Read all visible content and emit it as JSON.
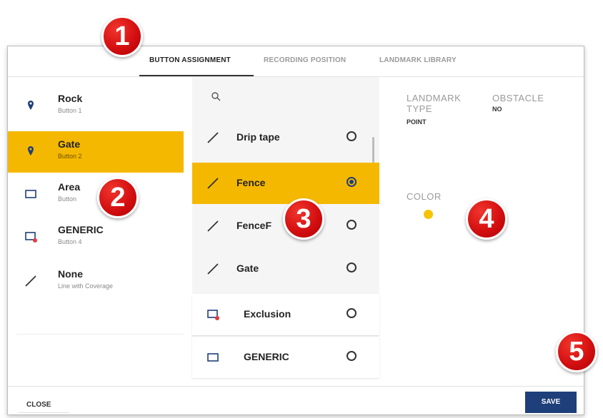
{
  "tabs": [
    {
      "label": "BUTTON ASSIGNMENT",
      "active": true
    },
    {
      "label": "RECORDING POSITION",
      "active": false
    },
    {
      "label": "LANDMARK LIBRARY",
      "active": false
    }
  ],
  "buttons": [
    {
      "title": "Rock",
      "sub": "Button 1",
      "icon": "map-pin-icon",
      "selected": false
    },
    {
      "title": "Gate",
      "sub": "Button 2",
      "icon": "map-pin-icon",
      "selected": true
    },
    {
      "title": "Area",
      "sub": "Button",
      "icon": "rectangle-icon",
      "selected": false
    },
    {
      "title": "GENERIC",
      "sub": "Button 4",
      "icon": "rectangle-flag-icon",
      "selected": false
    },
    {
      "title": "None",
      "sub": "Line with Coverage",
      "icon": "line-icon",
      "selected": false
    }
  ],
  "landmarks": [
    {
      "label": "Drip tape",
      "icon": "line-icon",
      "selected": false
    },
    {
      "label": "Fence",
      "icon": "line-icon",
      "selected": true
    },
    {
      "label": "FenceF",
      "icon": "line-icon",
      "selected": false
    },
    {
      "label": "Gate",
      "icon": "line-icon",
      "selected": false
    },
    {
      "label": "Exclusion",
      "icon": "rectangle-flag-icon",
      "selected": false
    },
    {
      "label": "GENERIC",
      "icon": "rectangle-icon",
      "selected": false
    }
  ],
  "details": {
    "landmark_type_label_1": "LANDMARK",
    "landmark_type_label_2": "TYPE",
    "landmark_type_value": "POINT",
    "obstacle_label": "OBSTACLE",
    "obstacle_value": "NO",
    "color_label": "COLOR",
    "color_value": "#f5c400"
  },
  "footer": {
    "close_label": "CLOSE",
    "save_label": "SAVE"
  },
  "callouts": [
    "1",
    "2",
    "3",
    "4",
    "5"
  ],
  "colors": {
    "selected": "#f5b800",
    "primary": "#1f3f7a",
    "callout": "#d40f10"
  }
}
